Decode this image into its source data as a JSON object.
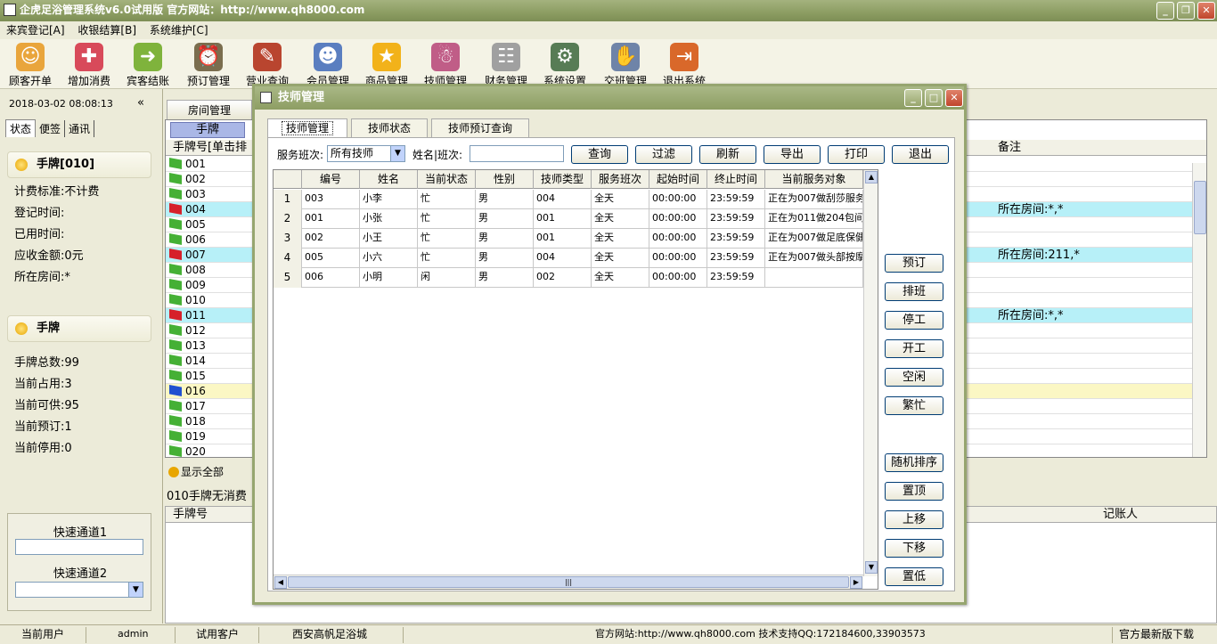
{
  "window": {
    "title": "企虎足浴管理系统v6.0试用版 官方网站：http://www.qh8000.com"
  },
  "menu": [
    "来宾登记[A]",
    "收银结算[B]",
    "系统维护[C]"
  ],
  "toolbar": [
    {
      "label": "顾客开单",
      "icon": "customer-icon",
      "color": "#e9a53c"
    },
    {
      "label": "增加消费",
      "icon": "add-consumption-icon",
      "color": "#d84a5a"
    },
    {
      "label": "宾客结账",
      "icon": "checkout-icon",
      "color": "#7fb33c"
    },
    {
      "label": "预订管理",
      "icon": "alarm-clock-icon",
      "color": "#7a6d4e"
    },
    {
      "label": "营业查询",
      "icon": "query-icon",
      "color": "#b9452f"
    },
    {
      "label": "会员管理",
      "icon": "members-icon",
      "color": "#5a7ec0"
    },
    {
      "label": "商品管理",
      "icon": "star-icon",
      "color": "#f2b21a"
    },
    {
      "label": "技师管理",
      "icon": "technician-icon",
      "color": "#c05d87"
    },
    {
      "label": "财务管理",
      "icon": "finance-icon",
      "color": "#a0a0a0"
    },
    {
      "label": "系统设置",
      "icon": "settings-icon",
      "color": "#577c55"
    },
    {
      "label": "交班管理",
      "icon": "handshake-icon",
      "color": "#6f84a8"
    },
    {
      "label": "退出系统",
      "icon": "exit-door-icon",
      "color": "#d9682a"
    }
  ],
  "left": {
    "datetime": "2018-03-02 08:08:13",
    "collapse": "«",
    "tabs": [
      "状态",
      "便签",
      "通讯"
    ],
    "card1": {
      "title": "手牌[010]",
      "lines": [
        "计费标准:不计费",
        "登记时间:",
        "已用时间:",
        "应收金额:0元",
        "所在房间:*"
      ]
    },
    "card2": {
      "title": "手牌",
      "lines": [
        "手牌总数:99",
        "当前占用:3",
        "当前可供:95",
        "当前预订:1",
        "当前停用:0"
      ]
    },
    "quick1": "快速通道1",
    "quick2": "快速通道2"
  },
  "main": {
    "room_tab": "房间管理",
    "tag_header": "手牌",
    "col_number": "手牌号[单击排",
    "col_note": "备注",
    "rows": [
      {
        "num": "001",
        "flag": "#45b035",
        "bg": "#ffffff",
        "note": ""
      },
      {
        "num": "002",
        "flag": "#45b035",
        "bg": "#ffffff",
        "note": ""
      },
      {
        "num": "003",
        "flag": "#45b035",
        "bg": "#ffffff",
        "note": ""
      },
      {
        "num": "004",
        "flag": "#d6202a",
        "bg": "#b7f0f8",
        "note": "所在房间:*,*"
      },
      {
        "num": "005",
        "flag": "#45b035",
        "bg": "#ffffff",
        "note": ""
      },
      {
        "num": "006",
        "flag": "#45b035",
        "bg": "#ffffff",
        "note": ""
      },
      {
        "num": "007",
        "flag": "#d6202a",
        "bg": "#b7f0f8",
        "note": "所在房间:211,*"
      },
      {
        "num": "008",
        "flag": "#45b035",
        "bg": "#ffffff",
        "note": ""
      },
      {
        "num": "009",
        "flag": "#45b035",
        "bg": "#ffffff",
        "note": ""
      },
      {
        "num": "010",
        "flag": "#45b035",
        "bg": "#ffffff",
        "note": ""
      },
      {
        "num": "011",
        "flag": "#d6202a",
        "bg": "#b7f0f8",
        "note": "所在房间:*,*"
      },
      {
        "num": "012",
        "flag": "#45b035",
        "bg": "#ffffff",
        "note": ""
      },
      {
        "num": "013",
        "flag": "#45b035",
        "bg": "#ffffff",
        "note": ""
      },
      {
        "num": "014",
        "flag": "#45b035",
        "bg": "#ffffff",
        "note": ""
      },
      {
        "num": "015",
        "flag": "#45b035",
        "bg": "#ffffff",
        "note": ""
      },
      {
        "num": "016",
        "flag": "#2050d0",
        "bg": "#fbf7c4",
        "note": ""
      },
      {
        "num": "017",
        "flag": "#45b035",
        "bg": "#ffffff",
        "note": ""
      },
      {
        "num": "018",
        "flag": "#45b035",
        "bg": "#ffffff",
        "note": ""
      },
      {
        "num": "019",
        "flag": "#45b035",
        "bg": "#ffffff",
        "note": ""
      },
      {
        "num": "020",
        "flag": "#45b035",
        "bg": "#ffffff",
        "note": ""
      }
    ],
    "show_all": "显示全部",
    "status_line": "010手牌无消费",
    "grid2_col1": "手牌号",
    "grid2_col2": "记账人"
  },
  "dialog": {
    "title": "技师管理",
    "tabs": [
      "技师管理",
      "技师状态",
      "技师预订查询"
    ],
    "shift_label": "服务班次:",
    "shift_value": "所有技师",
    "name_label": "姓名|班次:",
    "actions": [
      "查询",
      "过滤",
      "刷新",
      "导出",
      "打印",
      "退出"
    ],
    "side_buttons": [
      "预订",
      "排班",
      "停工",
      "开工",
      "空闲",
      "繁忙",
      "随机排序",
      "置顶",
      "上移",
      "下移",
      "置低"
    ],
    "columns": [
      "编号",
      "姓名",
      "当前状态",
      "性别",
      "技师类型",
      "服务班次",
      "起始时间",
      "终止时间",
      "当前服务对象"
    ],
    "rows": [
      {
        "rn": "1",
        "cells": [
          "003",
          "小李",
          "忙",
          "男",
          "004",
          "全天",
          "00:00:00",
          "23:59:59",
          "正在为007做刮莎服务"
        ]
      },
      {
        "rn": "2",
        "cells": [
          "001",
          "小张",
          "忙",
          "男",
          "001",
          "全天",
          "00:00:00",
          "23:59:59",
          "正在为011做204包间"
        ]
      },
      {
        "rn": "3",
        "cells": [
          "002",
          "小王",
          "忙",
          "男",
          "001",
          "全天",
          "00:00:00",
          "23:59:59",
          "正在为007做足底保健"
        ]
      },
      {
        "rn": "4",
        "cells": [
          "005",
          "小六",
          "忙",
          "男",
          "004",
          "全天",
          "00:00:00",
          "23:59:59",
          "正在为007做头部按摩"
        ]
      },
      {
        "rn": "5",
        "cells": [
          "006",
          "小明",
          "闲",
          "男",
          "002",
          "全天",
          "00:00:00",
          "23:59:59",
          ""
        ]
      }
    ]
  },
  "status": {
    "user_label": "当前用户",
    "user": "admin",
    "customer": "试用客户",
    "company": "西安高帆足浴城",
    "site": "官方网站:http://www.qh8000.com 技术支持QQ:172184600,33903573",
    "download": "官方最新版下载"
  }
}
